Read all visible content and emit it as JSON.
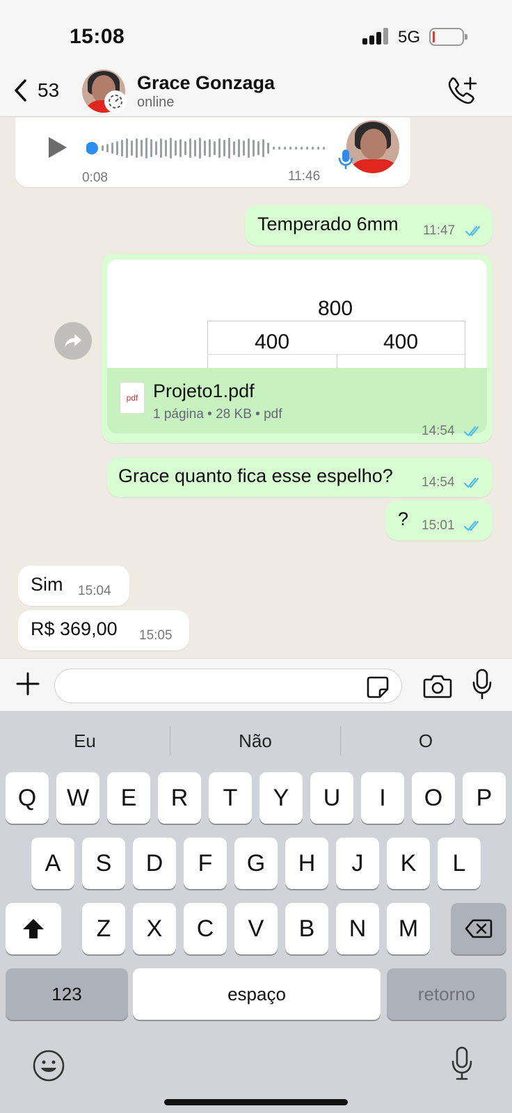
{
  "status_bar": {
    "time": "15:08",
    "network": "5G",
    "battery_level_percent": 5
  },
  "header": {
    "back_count": "53",
    "contact_name": "Grace Gonzaga",
    "contact_status": "online"
  },
  "messages": {
    "voice": {
      "duration": "0:08",
      "time": "11:46"
    },
    "msg1": {
      "text": "Temperado 6mm",
      "time": "11:47"
    },
    "pdf": {
      "preview_top": "800",
      "preview_left": "400",
      "preview_right": "400",
      "icon_label": "pdf",
      "file_name": "Projeto1.pdf",
      "meta": "1 página • 28 KB • pdf",
      "time": "14:54"
    },
    "msg2": {
      "text": "Grace quanto fica esse espelho?",
      "time": "14:54"
    },
    "msg3": {
      "text": "?",
      "time": "15:01"
    },
    "msg4": {
      "text": "Sim",
      "time": "15:04"
    },
    "msg5": {
      "text": "R$ 369,00",
      "time": "15:05"
    }
  },
  "input": {
    "placeholder": ""
  },
  "keyboard": {
    "suggestions": [
      "Eu",
      "Não",
      "O"
    ],
    "row1": [
      "Q",
      "W",
      "E",
      "R",
      "T",
      "Y",
      "U",
      "I",
      "O",
      "P"
    ],
    "row2": [
      "A",
      "S",
      "D",
      "F",
      "G",
      "H",
      "J",
      "K",
      "L"
    ],
    "row3": [
      "Z",
      "X",
      "C",
      "V",
      "B",
      "N",
      "M"
    ],
    "numbers_label": "123",
    "space_label": "espaço",
    "return_label": "retorno"
  },
  "colors": {
    "outgoing_bubble": "#d9fdd3",
    "incoming_bubble": "#ffffff",
    "read_ticks": "#53bdeb",
    "background": "#efeae2"
  }
}
